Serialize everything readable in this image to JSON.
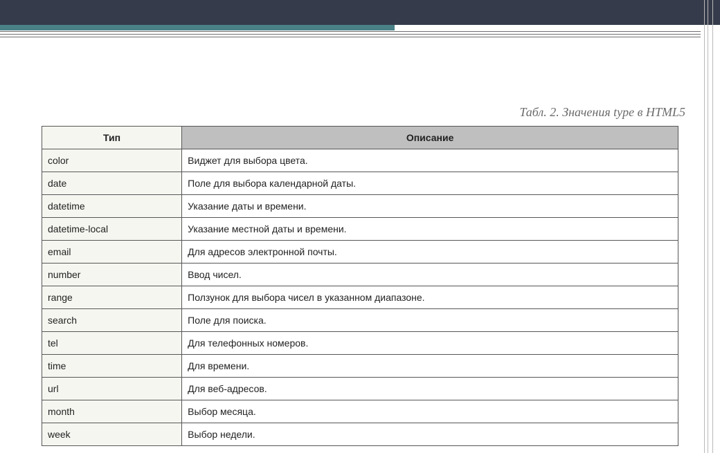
{
  "caption": "Табл. 2. Значения type в HTML5",
  "headers": {
    "type": "Тип",
    "desc": "Описание"
  },
  "rows": [
    {
      "type": "color",
      "desc": "Виджет для выбора цвета."
    },
    {
      "type": "date",
      "desc": "Поле для выбора календарной даты."
    },
    {
      "type": "datetime",
      "desc": "Указание даты и времени."
    },
    {
      "type": "datetime-local",
      "desc": "Указание местной даты и времени."
    },
    {
      "type": "email",
      "desc": "Для адресов электронной почты."
    },
    {
      "type": "number",
      "desc": "Ввод чисел."
    },
    {
      "type": "range",
      "desc": "Ползунок для выбора чисел в указанном диапазоне."
    },
    {
      "type": "search",
      "desc": "Поле для поиска."
    },
    {
      "type": "tel",
      "desc": "Для телефонных номеров."
    },
    {
      "type": "time",
      "desc": "Для времени."
    },
    {
      "type": "url",
      "desc": "Для веб-адресов."
    },
    {
      "type": "month",
      "desc": "Выбор месяца."
    },
    {
      "type": "week",
      "desc": "Выбор недели."
    }
  ]
}
